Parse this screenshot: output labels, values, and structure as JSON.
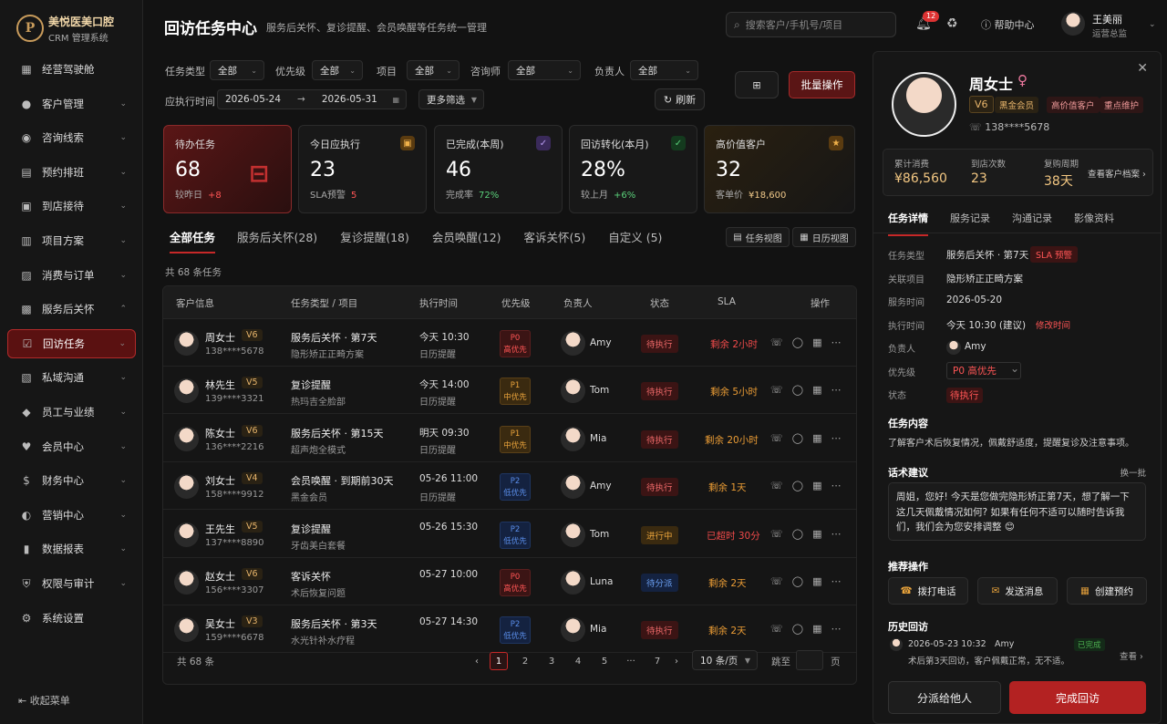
{
  "brand": {
    "name": "美悦医美口腔",
    "sub": "CRM 管理系统",
    "logo_char": "P"
  },
  "sidebar": {
    "items": [
      {
        "label": "经营驾驶舱",
        "icon": "dashboard-icon",
        "glyph": "▦",
        "arrow": ""
      },
      {
        "label": "客户管理",
        "icon": "user-icon",
        "glyph": "●",
        "arrow": "⌄"
      },
      {
        "label": "咨询线索",
        "icon": "chat-icon",
        "glyph": "◉",
        "arrow": "⌄"
      },
      {
        "label": "预约排班",
        "icon": "calendar-icon",
        "glyph": "▤",
        "arrow": "⌄"
      },
      {
        "label": "到店接待",
        "icon": "reception-icon",
        "glyph": "▣",
        "arrow": "⌄"
      },
      {
        "label": "项目方案",
        "icon": "document-icon",
        "glyph": "▥",
        "arrow": "⌄"
      },
      {
        "label": "消费与订单",
        "icon": "cart-icon",
        "glyph": "▨",
        "arrow": "⌄"
      },
      {
        "label": "服务后关怀",
        "icon": "care-icon",
        "glyph": "▩",
        "arrow": "⌃"
      },
      {
        "label": "回访任务",
        "icon": "checkbox-icon",
        "glyph": "☑",
        "arrow": "⌄"
      },
      {
        "label": "私域沟通",
        "icon": "message-icon",
        "glyph": "▧",
        "arrow": "⌄"
      },
      {
        "label": "员工与业绩",
        "icon": "staff-icon",
        "glyph": "◆",
        "arrow": "⌄"
      },
      {
        "label": "会员中心",
        "icon": "heart-icon",
        "glyph": "♥",
        "arrow": "⌄"
      },
      {
        "label": "财务中心",
        "icon": "finance-icon",
        "glyph": "$",
        "arrow": "⌄"
      },
      {
        "label": "营销中心",
        "icon": "marketing-icon",
        "glyph": "◐",
        "arrow": "⌄"
      },
      {
        "label": "数据报表",
        "icon": "chart-icon",
        "glyph": "▮",
        "arrow": "⌄"
      },
      {
        "label": "权限与审计",
        "icon": "shield-icon",
        "glyph": "⛨",
        "arrow": "⌄"
      },
      {
        "label": "系统设置",
        "icon": "gear-icon",
        "glyph": "⚙",
        "arrow": ""
      }
    ],
    "collapse": "收起菜单"
  },
  "header": {
    "title": "回访任务中心",
    "subtitle": "服务后关怀、复诊提醒、会员唤醒等任务统一管理",
    "search_placeholder": "搜索客户/手机号/项目",
    "notif_count": "12",
    "help": "帮助中心",
    "user_name": "王美丽",
    "user_role": "运营总监"
  },
  "filters": {
    "row1": [
      {
        "label": "任务类型",
        "value": "全部"
      },
      {
        "label": "优先级",
        "value": "全部"
      },
      {
        "label": "项目",
        "value": "全部"
      },
      {
        "label": "咨询师",
        "value": "全部"
      },
      {
        "label": "负责人",
        "value": "全部"
      }
    ],
    "date_label": "应执行时间",
    "date_from": "2026-05-24",
    "date_arrow": "→",
    "date_to": "2026-05-31",
    "more": "更多筛选",
    "refresh": "刷新",
    "bulk": "批量操作"
  },
  "cards": [
    {
      "title": "待办任务",
      "value": "68",
      "sub": "较昨日",
      "delta": "+8"
    },
    {
      "title": "今日应执行",
      "value": "23",
      "sub": "SLA预警",
      "delta": "5"
    },
    {
      "title": "已完成(本周)",
      "value": "46",
      "sub": "完成率",
      "delta": "72%"
    },
    {
      "title": "回访转化(本月)",
      "value": "28%",
      "sub": "较上月",
      "delta": "+6%"
    },
    {
      "title": "高价值客户",
      "value": "32",
      "sub": "客单价",
      "delta": "¥18,600"
    }
  ],
  "tabs": [
    "全部任务",
    "服务后关怀(28)",
    "复诊提醒(18)",
    "会员唤醒(12)",
    "客诉关怀(5)",
    "自定义 (5)"
  ],
  "views": {
    "task": "任务视图",
    "calendar": "日历视图"
  },
  "total_top": "共 68 条任务",
  "table": {
    "headers": [
      "客户信息",
      "任务类型 / 项目",
      "执行时间",
      "优先级",
      "负责人",
      "状态",
      "SLA",
      "操作"
    ],
    "rows": [
      {
        "name": "周女士",
        "level": "V6",
        "phone": "138****5678",
        "type": "服务后关怀 · 第7天",
        "project": "隐形矫正正畸方案",
        "time": "今天 10:30",
        "reminder": "日历提醒",
        "p": "P0",
        "pl": "高优先",
        "pc": "p0",
        "owner": "Amy",
        "status": "待执行",
        "sc": "a",
        "sla": "剩余 2小时",
        "slc": "r"
      },
      {
        "name": "林先生",
        "level": "V5",
        "phone": "139****3321",
        "type": "复诊提醒",
        "project": "热玛吉全脸部",
        "time": "今天 14:00",
        "reminder": "日历提醒",
        "p": "P1",
        "pl": "中优先",
        "pc": "p1",
        "owner": "Tom",
        "status": "待执行",
        "sc": "a",
        "sla": "剩余 5小时",
        "slc": "o"
      },
      {
        "name": "陈女士",
        "level": "V6",
        "phone": "136****2216",
        "type": "服务后关怀 · 第15天",
        "project": "超声炮全模式",
        "time": "明天 09:30",
        "reminder": "日历提醒",
        "p": "P1",
        "pl": "中优先",
        "pc": "p1",
        "owner": "Mia",
        "status": "待执行",
        "sc": "a",
        "sla": "剩余 20小时",
        "slc": "o"
      },
      {
        "name": "刘女士",
        "level": "V4",
        "phone": "158****9912",
        "type": "会员唤醒 · 到期前30天",
        "project": "黑金会员",
        "time": "05-26 11:00",
        "reminder": "日历提醒",
        "p": "P2",
        "pl": "低优先",
        "pc": "p2",
        "owner": "Amy",
        "status": "待执行",
        "sc": "a",
        "sla": "剩余 1天",
        "slc": "o"
      },
      {
        "name": "王先生",
        "level": "V5",
        "phone": "137****8890",
        "type": "复诊提醒",
        "project": "牙齿美白套餐",
        "time": "05-26 15:30",
        "reminder": "",
        "p": "P2",
        "pl": "低优先",
        "pc": "p2",
        "owner": "Tom",
        "status": "进行中",
        "sc": "b",
        "sla": "已超时 30分",
        "slc": "r"
      },
      {
        "name": "赵女士",
        "level": "V6",
        "phone": "156****3307",
        "type": "客诉关怀",
        "project": "术后恢复问题",
        "time": "05-27 10:00",
        "reminder": "",
        "p": "P0",
        "pl": "高优先",
        "pc": "p0",
        "owner": "Luna",
        "status": "待分派",
        "sc": "c",
        "sla": "剩余 2天",
        "slc": "o"
      },
      {
        "name": "吴女士",
        "level": "V3",
        "phone": "159****6678",
        "type": "服务后关怀 · 第3天",
        "project": "水光针补水疗程",
        "time": "05-27 14:30",
        "reminder": "",
        "p": "P2",
        "pl": "低优先",
        "pc": "p2",
        "owner": "Mia",
        "status": "待执行",
        "sc": "a",
        "sla": "剩余 2天",
        "slc": "o"
      }
    ]
  },
  "pagination": {
    "total": "共 68 条",
    "pages": [
      "1",
      "2",
      "3",
      "4",
      "5",
      "···",
      "7"
    ],
    "size": "10 条/页",
    "jump": "跳至",
    "unit": "页"
  },
  "detail": {
    "name": "周女士",
    "gender": "♀",
    "level": "V6",
    "tags": [
      "黑金会员",
      "高价值客户",
      "重点维护"
    ],
    "phone": "138****5678",
    "stats": [
      {
        "k": "累计消费",
        "v": "¥86,560"
      },
      {
        "k": "到店次数",
        "v": "23"
      },
      {
        "k": "复购周期",
        "v": "38天"
      }
    ],
    "archive": "查看客户档案 ›",
    "tabs": [
      "任务详情",
      "服务记录",
      "沟通记录",
      "影像资料"
    ],
    "fields": [
      {
        "k": "任务类型",
        "v": "服务后关怀 · 第7天",
        "extra": "SLA 预警"
      },
      {
        "k": "关联项目",
        "v": "隐形矫正正畸方案",
        "extra": ""
      },
      {
        "k": "服务时间",
        "v": "2026-05-20",
        "extra": ""
      },
      {
        "k": "执行时间",
        "v": "今天 10:30 (建议)",
        "extra": "修改时间"
      },
      {
        "k": "负责人",
        "v": "Amy",
        "extra": ""
      },
      {
        "k": "优先级",
        "v": "P0  高优先",
        "extra": ""
      },
      {
        "k": "状态",
        "v": "待执行",
        "extra": ""
      }
    ],
    "content_title": "任务内容",
    "content": "了解客户术后恢复情况，佩戴舒适度，提醒复诊及注意事项。",
    "script_title": "话术建议",
    "script_switch": "换一批",
    "script": "周姐，您好! 今天是您做完隐形矫正第7天，想了解一下这几天佩戴情况如何? 如果有任何不适可以随时告诉我们，我们会为您安排调整 😊",
    "actions_title": "推荐操作",
    "actions": [
      "拨打电话",
      "发送消息",
      "创建预约"
    ],
    "history_title": "历史回访",
    "history_date": "2026-05-23 10:32",
    "history_owner": "Amy",
    "history_status": "已完成",
    "history_text": "术后第3天回访，客户佩戴正常，无不适。",
    "history_more": "查看 ›",
    "reassign": "分派给他人",
    "complete": "完成回访"
  },
  "colors": {
    "accent": "#c62828",
    "gold": "#e8b56b"
  }
}
